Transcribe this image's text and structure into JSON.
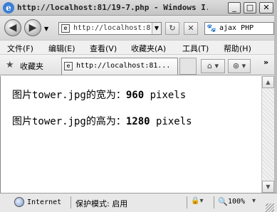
{
  "window": {
    "title": "http://localhost:81/19-7.php - Windows I...",
    "minimize_glyph": "_",
    "maximize_glyph": "□",
    "close_glyph": "✕"
  },
  "nav": {
    "address": "http://localhost:8",
    "search_query": "ajax PHP",
    "back_icon": "back-arrow-icon",
    "forward_icon": "forward-arrow-icon"
  },
  "menu": {
    "items": [
      "文件(F)",
      "编辑(E)",
      "查看(V)",
      "收藏夹(A)",
      "工具(T)",
      "帮助(H)"
    ]
  },
  "favorites": {
    "label": "收藏夹",
    "tab_label": "http://localhost:81..."
  },
  "content": {
    "width_prefix": "图片tower.jpg的宽为：",
    "width_value": "960",
    "width_unit": " pixels",
    "height_prefix": "图片tower.jpg的高为：",
    "height_value": "1280",
    "height_unit": " pixels"
  },
  "status": {
    "zone": "Internet",
    "protected_mode": "保护模式: 启用",
    "zoom": "100%"
  }
}
